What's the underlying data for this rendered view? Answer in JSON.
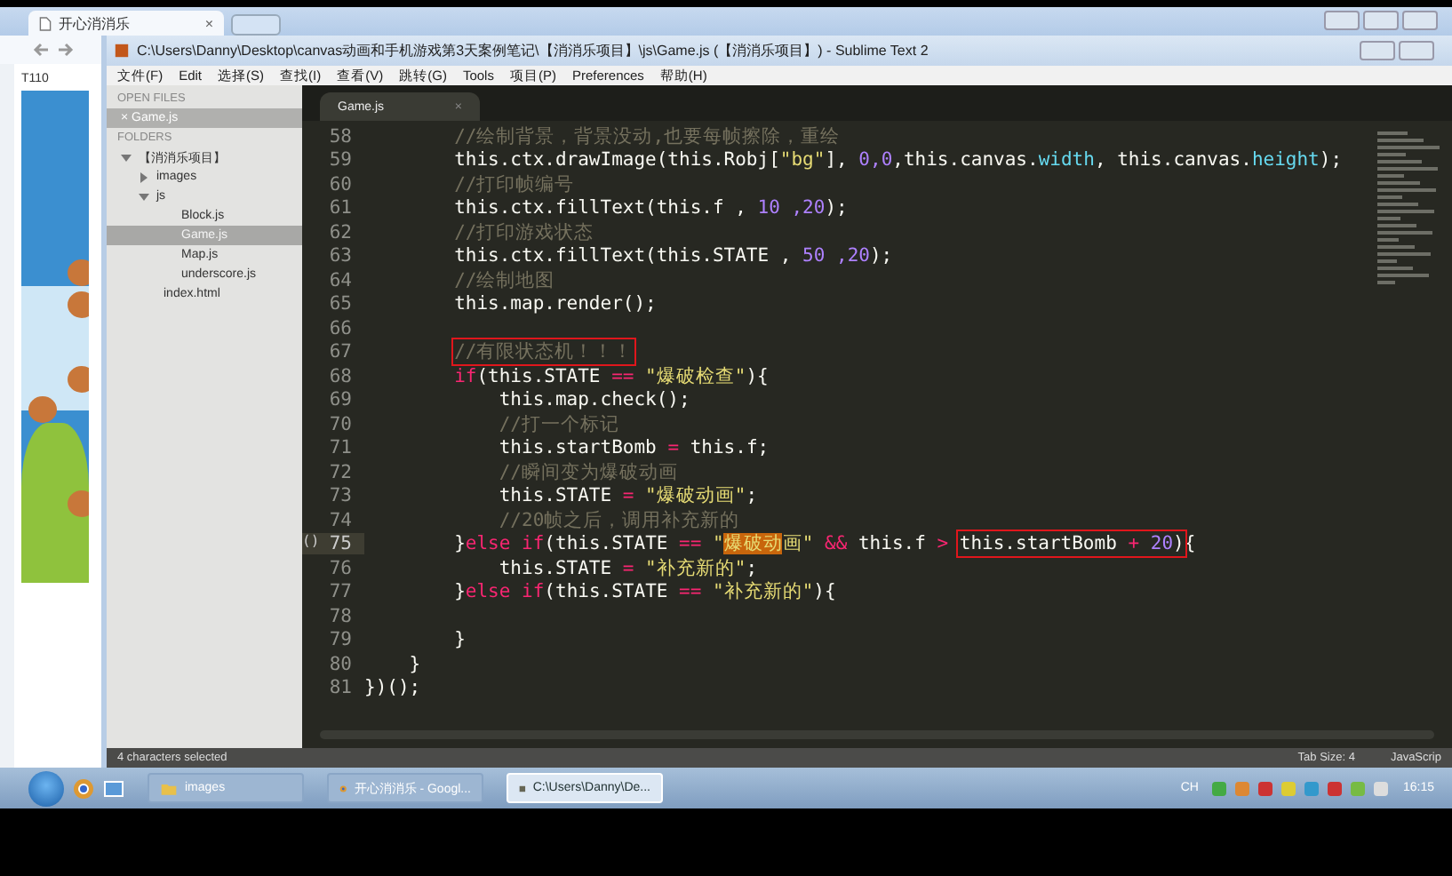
{
  "browser": {
    "tab": {
      "title": "开心消消乐",
      "close": "×"
    },
    "page": {
      "score": "T110"
    }
  },
  "editor_window": {
    "title": "C:\\Users\\Danny\\Desktop\\canvas动画和手机游戏第3天案例笔记\\【消消乐项目】\\js\\Game.js (【消消乐项目】) - Sublime Text 2",
    "menu": [
      "文件(F)",
      "Edit",
      "选择(S)",
      "查找(I)",
      "查看(V)",
      "跳转(G)",
      "Tools",
      "项目(P)",
      "Preferences",
      "帮助(H)"
    ],
    "sidebar": {
      "open_files_heading": "OPEN FILES",
      "open_files": [
        {
          "close": "×",
          "label": "Game.js",
          "selected": true
        }
      ],
      "folders_heading": "FOLDERS",
      "tree": [
        {
          "label": "【消消乐项目】",
          "expanded": true,
          "selected": false,
          "children": [
            {
              "label": "images",
              "expanded": false,
              "selected": false
            },
            {
              "label": "js",
              "expanded": true,
              "selected": false,
              "children": [
                {
                  "label": "Block.js",
                  "selected": false
                },
                {
                  "label": "Game.js",
                  "selected": true
                },
                {
                  "label": "Map.js",
                  "selected": false
                },
                {
                  "label": "underscore.js",
                  "selected": false
                }
              ]
            },
            {
              "label": "index.html",
              "selected": false
            }
          ]
        }
      ]
    },
    "tabs": [
      {
        "label": "Game.js",
        "close": "×",
        "selected": true
      }
    ],
    "lines": [
      {
        "number": "58",
        "current": false,
        "tokens": [
          {
            "kind": "comment",
            "text": "        //绘制背景，背景没动,也要每帧擦除，重绘"
          }
        ]
      },
      {
        "number": "59",
        "current": false,
        "tokens": [
          {
            "kind": "plain",
            "text": "        this.ctx.drawImage(this.Robj["
          },
          {
            "kind": "string",
            "text": "\"bg\""
          },
          {
            "kind": "plain",
            "text": "], "
          },
          {
            "kind": "number",
            "text": "0,0"
          },
          {
            "kind": "plain",
            "text": ",this.canvas."
          },
          {
            "kind": "property",
            "text": "width"
          },
          {
            "kind": "plain",
            "text": ", this.canvas."
          },
          {
            "kind": "property",
            "text": "height"
          },
          {
            "kind": "plain",
            "text": ");"
          }
        ]
      },
      {
        "number": "60",
        "current": false,
        "tokens": [
          {
            "kind": "comment",
            "text": "        //打印帧编号"
          }
        ]
      },
      {
        "number": "61",
        "current": false,
        "tokens": [
          {
            "kind": "plain",
            "text": "        this.ctx.fillText(this.f , "
          },
          {
            "kind": "number",
            "text": "10 ,20"
          },
          {
            "kind": "plain",
            "text": ");"
          }
        ]
      },
      {
        "number": "62",
        "current": false,
        "tokens": [
          {
            "kind": "comment",
            "text": "        //打印游戏状态"
          }
        ]
      },
      {
        "number": "63",
        "current": false,
        "tokens": [
          {
            "kind": "plain",
            "text": "        this.ctx.fillText(this.STATE , "
          },
          {
            "kind": "number",
            "text": "50 ,20"
          },
          {
            "kind": "plain",
            "text": ");"
          }
        ]
      },
      {
        "number": "64",
        "current": false,
        "tokens": [
          {
            "kind": "comment",
            "text": "        //绘制地图"
          }
        ]
      },
      {
        "number": "65",
        "current": false,
        "tokens": [
          {
            "kind": "plain",
            "text": "        this.map.render();"
          }
        ]
      },
      {
        "number": "66",
        "current": false
      },
      {
        "number": "67",
        "current": false,
        "tokens": [
          {
            "kind": "annotation",
            "tokens": [
              {
                "kind": "comment",
                "text": "        //有限状态机！！！"
              }
            ]
          }
        ]
      },
      {
        "number": "68",
        "current": false,
        "tokens": [
          {
            "kind": "keyword",
            "text": "        if"
          },
          {
            "kind": "plain",
            "text": "(this.STATE "
          },
          {
            "kind": "operator",
            "text": "=="
          },
          {
            "kind": "string",
            "text": " \"爆破检查\""
          },
          {
            "kind": "plain",
            "text": "){"
          }
        ]
      },
      {
        "number": "69",
        "current": false,
        "tokens": [
          {
            "kind": "plain",
            "text": "            this.map.check();"
          }
        ]
      },
      {
        "number": "70",
        "current": false,
        "tokens": [
          {
            "kind": "comment",
            "text": "            //打一个标记"
          }
        ]
      },
      {
        "number": "71",
        "current": false,
        "tokens": [
          {
            "kind": "plain",
            "text": "            this.startBomb "
          },
          {
            "kind": "operator",
            "text": "="
          },
          {
            "kind": "plain",
            "text": " this.f;"
          }
        ]
      },
      {
        "number": "72",
        "current": false,
        "tokens": [
          {
            "kind": "comment",
            "text": "            //瞬间变为爆破动画"
          }
        ]
      },
      {
        "number": "73",
        "current": false,
        "tokens": [
          {
            "kind": "plain",
            "text": "            this.STATE "
          },
          {
            "kind": "operator",
            "text": "="
          },
          {
            "kind": "string",
            "text": " \"爆破动画\""
          },
          {
            "kind": "plain",
            "text": ";"
          }
        ]
      },
      {
        "number": "74",
        "current": false,
        "tokens": [
          {
            "kind": "comment",
            "text": "            //20帧之后，调用补充新的"
          }
        ]
      },
      {
        "number": "75",
        "current": true,
        "marker": "()",
        "tokens": [
          {
            "kind": "plain",
            "text": "        }"
          },
          {
            "kind": "keyword",
            "text": "else if"
          },
          {
            "kind": "plain",
            "text": "(this.STATE "
          },
          {
            "kind": "operator",
            "text": "=="
          },
          {
            "kind": "string",
            "text": " \""
          },
          {
            "kind": "selection",
            "text": "爆破动"
          },
          {
            "kind": "string",
            "text": "画\" "
          },
          {
            "kind": "operator",
            "text": "&&"
          },
          {
            "kind": "plain",
            "text": " this.f "
          },
          {
            "kind": "operator",
            "text": ">"
          },
          {
            "kind": "annotation",
            "tokens": [
              {
                "kind": "plain",
                "text": " this.startBomb "
              },
              {
                "kind": "operator",
                "text": "+"
              },
              {
                "kind": "number",
                "text": " 20"
              },
              {
                "kind": "plain",
                "text": ")"
              }
            ]
          },
          {
            "kind": "plain",
            "text": "{"
          }
        ]
      },
      {
        "number": "76",
        "current": false,
        "tokens": [
          {
            "kind": "plain",
            "text": "            this.STATE "
          },
          {
            "kind": "operator",
            "text": "="
          },
          {
            "kind": "string",
            "text": " \"补充新的\""
          },
          {
            "kind": "plain",
            "text": ";"
          }
        ]
      },
      {
        "number": "77",
        "current": false,
        "tokens": [
          {
            "kind": "plain",
            "text": "        }"
          },
          {
            "kind": "keyword",
            "text": "else if"
          },
          {
            "kind": "plain",
            "text": "(this.STATE "
          },
          {
            "kind": "operator",
            "text": "=="
          },
          {
            "kind": "string",
            "text": " \"补充新的\""
          },
          {
            "kind": "plain",
            "text": "){"
          }
        ]
      },
      {
        "number": "78",
        "current": false
      },
      {
        "number": "79",
        "current": false,
        "tokens": [
          {
            "kind": "plain",
            "text": "        }"
          }
        ]
      },
      {
        "number": "80",
        "current": false,
        "tokens": [
          {
            "kind": "plain",
            "text": "    }"
          }
        ]
      },
      {
        "number": "81",
        "current": false,
        "tokens": [
          {
            "kind": "plain",
            "text": "})();"
          }
        ]
      }
    ],
    "status_bar": {
      "message": "4 characters selected",
      "tab_size": "Tab Size: 4",
      "syntax": "JavaScrip"
    }
  },
  "taskbar": {
    "buttons": [
      {
        "label": "images",
        "selected": false
      },
      {
        "label": "开心消消乐 - Googl...",
        "selected": false
      },
      {
        "label": "C:\\Users\\Danny\\De...",
        "selected": true
      }
    ],
    "language": "CH",
    "time": "16:15"
  }
}
